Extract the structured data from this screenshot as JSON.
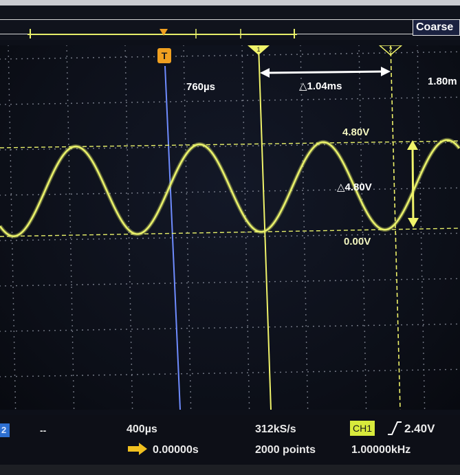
{
  "top_bar": {
    "coarse_button": "Coarse"
  },
  "markers": {
    "trigger_marker": "T",
    "cursor_1": "1",
    "cursor_2": "2"
  },
  "measurements": {
    "time_cursor_left": "760µs",
    "time_delta": "△1.04ms",
    "time_cursor_right": "1.80m",
    "voltage_upper": "4.80V",
    "voltage_delta": "△4.80V",
    "voltage_lower": "0.00V"
  },
  "status_bar": {
    "channel2_label": "2",
    "channel2_scale": "--",
    "time_per_div": "400µs",
    "trigger_position": "0.00000s",
    "sample_rate": "312kS/s",
    "record_length": "2000 points",
    "trigger_channel": "CH1",
    "trigger_level": "2.40V",
    "frequency": "1.00000kHz"
  },
  "colors": {
    "waveform": "#e8f06a",
    "cursor": "#f0f36a",
    "trigger_line": "#6f8cff",
    "trigger_marker": "#f0a020",
    "grid_dots": "#8a8f9c",
    "ch1_badge": "#d8ea3c",
    "ch2_badge": "#2d6fd0"
  },
  "chart_data": {
    "type": "line",
    "series": [
      {
        "shape": "sine",
        "frequency_hz": 1000,
        "min_v": 0.0,
        "max_v": 4.8
      }
    ]
  }
}
